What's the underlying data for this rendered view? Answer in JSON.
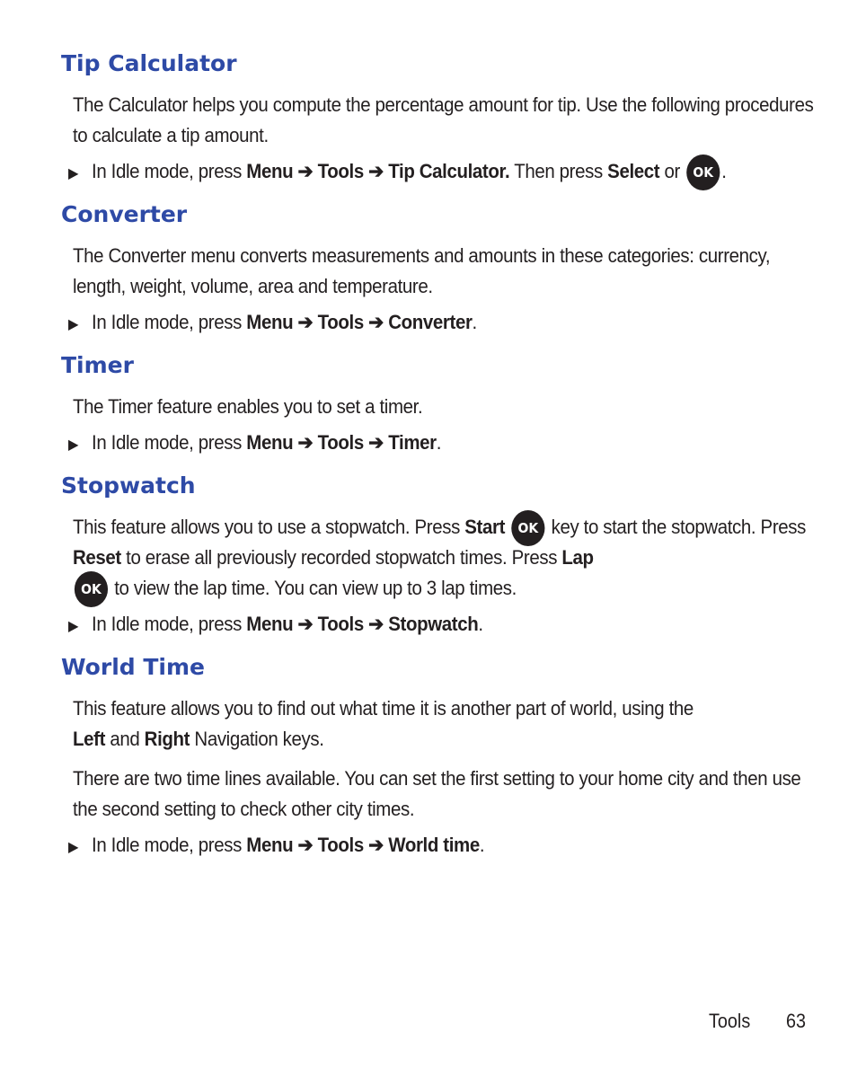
{
  "sections": [
    {
      "heading": "Tip Calculator",
      "paragraph": "The Calculator helps you compute the percentage amount for tip. Use the following procedures to calculate a tip amount.",
      "step": {
        "prefix": "In Idle mode, press",
        "menu": "Menu",
        "arrow": "➔",
        "tools": "Tools",
        "target": "Tip Calculator.",
        "then": " Then press ",
        "select": "Select",
        "or": " or ",
        "key": "OK",
        "end": "."
      }
    },
    {
      "heading": "Converter",
      "paragraph": "The Converter menu converts measurements and amounts in these categories: currency, length, weight, volume, area and temperature.",
      "step": {
        "prefix": "In Idle mode, press",
        "menu": "Menu",
        "arrow": "➔",
        "tools": "Tools",
        "target": "Converter",
        "end": "."
      }
    },
    {
      "heading": "Timer",
      "paragraph": "The Timer feature enables you to set a timer.",
      "step": {
        "prefix": "In Idle mode, press",
        "menu": "Menu",
        "arrow": "➔",
        "tools": "Tools",
        "target": "Timer",
        "end": "."
      }
    },
    {
      "heading": "Stopwatch",
      "paragraph": {
        "p1": "This feature allows you to use a stopwatch. Press ",
        "start": "Start",
        "p2": " key to start the stopwatch. Press ",
        "reset": "Reset",
        "p3": " to erase all previously recorded stopwatch times. Press ",
        "lap": "Lap",
        "p4": " to view the lap time. You can view up to 3 lap times.",
        "key": "OK"
      },
      "step": {
        "prefix": "In Idle mode, press",
        "menu": "Menu",
        "arrow": "➔",
        "tools": "Tools",
        "target": "Stopwatch",
        "end": "."
      }
    },
    {
      "heading": "World Time",
      "paragraph": {
        "p1": "This feature allows you to find out what time it is another part of world, using the ",
        "left": "Left",
        "and": " and ",
        "right": "Right",
        "p2": " Navigation keys."
      },
      "paragraph2": "There are two time lines available. You can set the first setting to your home city and then use the second setting to check other city times.",
      "step": {
        "prefix": "In Idle mode, press",
        "menu": "Menu",
        "arrow": "➔",
        "tools": "Tools",
        "target": "World time",
        "end": "."
      }
    }
  ],
  "footer": {
    "section": "Tools",
    "page": "63"
  },
  "bullet_glyph": "▶"
}
